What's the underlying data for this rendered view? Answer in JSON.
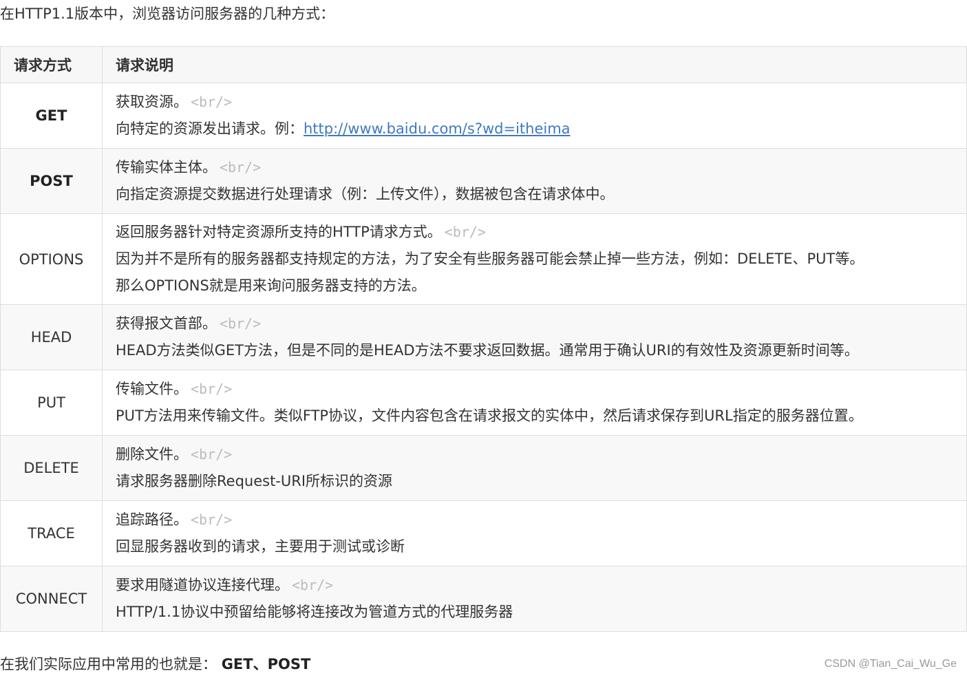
{
  "intro": "在HTTP1.1版本中，浏览器访问服务器的几种方式：",
  "table": {
    "headers": [
      "请求方式",
      "请求说明"
    ],
    "rows": [
      {
        "method": "GET",
        "bold": true,
        "line1": "获取资源。",
        "br": "<br/>",
        "line2_prefix": "向特定的资源发出请求。例：",
        "line2_link": "http://www.baidu.com/s?wd=itheima"
      },
      {
        "method": "POST",
        "bold": true,
        "line1": "传输实体主体。",
        "br": "<br/>",
        "line2": "向指定资源提交数据进行处理请求（例：上传文件），数据被包含在请求体中。"
      },
      {
        "method": "OPTIONS",
        "bold": false,
        "line1": "返回服务器针对特定资源所支持的HTTP请求方式。",
        "br": "<br/>",
        "line2": "因为并不是所有的服务器都支持规定的方法，为了安全有些服务器可能会禁止掉一些方法，例如：DELETE、PUT等。",
        "line3": "那么OPTIONS就是用来询问服务器支持的方法。"
      },
      {
        "method": "HEAD",
        "bold": false,
        "line1": "获得报文首部。",
        "br": "<br/>",
        "line2": "HEAD方法类似GET方法，但是不同的是HEAD方法不要求返回数据。通常用于确认URI的有效性及资源更新时间等。"
      },
      {
        "method": "PUT",
        "bold": false,
        "line1": "传输文件。",
        "br": "<br/>",
        "line2": "PUT方法用来传输文件。类似FTP协议，文件内容包含在请求报文的实体中，然后请求保存到URL指定的服务器位置。"
      },
      {
        "method": "DELETE",
        "bold": false,
        "line1": "删除文件。",
        "br": "<br/>",
        "line2": "请求服务器删除Request-URI所标识的资源"
      },
      {
        "method": "TRACE",
        "bold": false,
        "line1": "追踪路径。",
        "br": "<br/>",
        "line2": "回显服务器收到的请求，主要用于测试或诊断"
      },
      {
        "method": "CONNECT",
        "bold": false,
        "line1": "要求用隧道协议连接代理。",
        "br": "<br/>",
        "line2": "HTTP/1.1协议中预留给能够将连接改为管道方式的代理服务器"
      }
    ]
  },
  "summary": {
    "prefix": "在我们实际应用中常用的也就是：",
    "strong": "GET、POST"
  },
  "watermark": "CSDN @Tian_Cai_Wu_Ge",
  "colors": {
    "link": "#4078c0",
    "border": "#dddddd",
    "br_tag": "#bbbbbb",
    "stripe": "#f8f8f8"
  }
}
